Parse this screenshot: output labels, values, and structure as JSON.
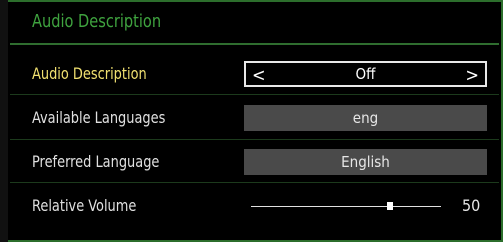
{
  "title": "Audio Description",
  "rows": [
    {
      "label": "Audio Description",
      "value": "Off"
    },
    {
      "label": "Available Languages",
      "value": "eng"
    },
    {
      "label": "Preferred Language",
      "value": "English"
    },
    {
      "label": "Relative Volume",
      "value": "50"
    }
  ],
  "arrows": {
    "left": "<",
    "right": ">"
  },
  "colors": {
    "accent": "#3fa33f",
    "selected_label": "#f0e070",
    "box_bg": "#4a4a4a"
  },
  "relative_volume_level_percent": 50
}
